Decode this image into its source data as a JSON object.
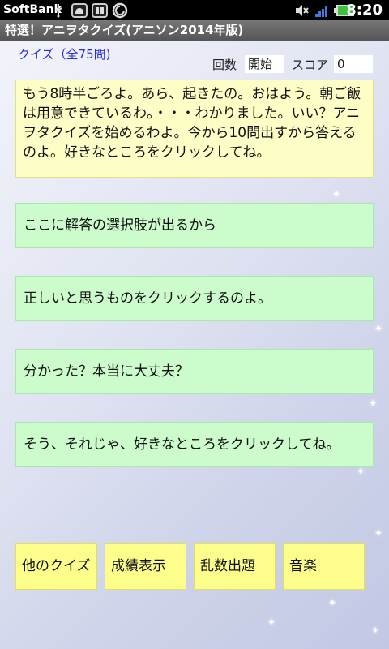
{
  "status": {
    "carrier": "SoftBank",
    "time": "8:20",
    "icons": [
      "usb-icon",
      "android-debug-icon",
      "sim-icon",
      "sync-icon",
      "mute-icon",
      "signal-icon",
      "battery-icon"
    ]
  },
  "app": {
    "title": "特選！アニヲタクイズ(アニソン2014年版)"
  },
  "header": {
    "quiz_count": "クイズ（全75問)",
    "round_label": "回数",
    "round_value": "開始",
    "score_label": "スコア",
    "score_value": "0"
  },
  "message": "もう8時半ごろよ。あら、起きたの。おはよう。朝ご飯は用意できているわ。・・・わかりました。いい？アニヲタクイズを始めるわよ。今から10問出すから答えるのよ。好きなところをクリックしてね。",
  "choices": [
    "ここに解答の選択肢が出るから",
    "正しいと思うものをクリックするのよ。",
    "分かった？本当に大丈夫？",
    "そう、それじゃ、好きなところをクリックしてね。"
  ],
  "buttons": [
    "他のクイズ",
    "成績表示",
    "乱数出題",
    "音楽"
  ],
  "colors": {
    "message_bg": "#fdfdc6",
    "choice_bg": "#ccfccc",
    "button_bg": "#fdfd8c",
    "quiz_count": "#2b2be0"
  }
}
